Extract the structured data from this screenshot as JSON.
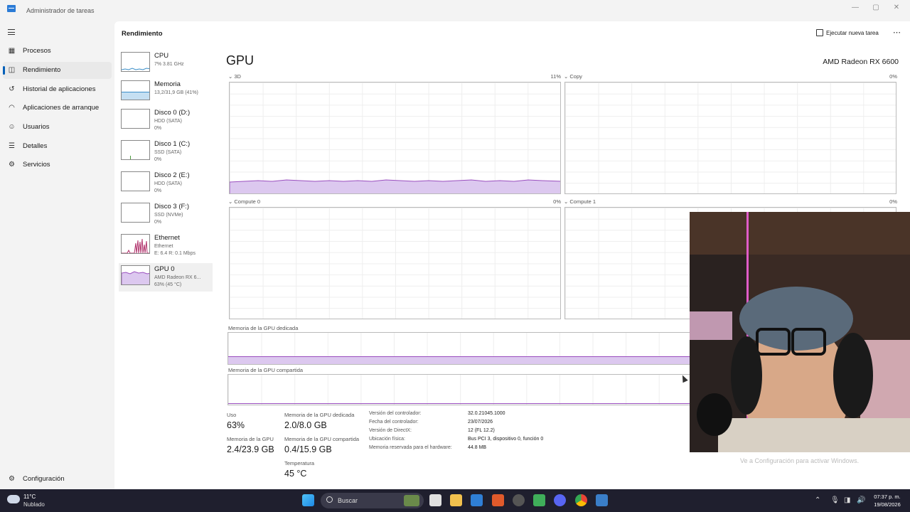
{
  "window": {
    "title": "Administrador de tareas",
    "minimize": "—",
    "maximize": "▢",
    "close": "✕"
  },
  "sidebar": {
    "items": [
      {
        "label": "Procesos",
        "icon": "processes-icon"
      },
      {
        "label": "Rendimiento",
        "icon": "performance-icon",
        "active": true
      },
      {
        "label": "Historial de aplicaciones",
        "icon": "history-icon"
      },
      {
        "label": "Aplicaciones de arranque",
        "icon": "startup-icon"
      },
      {
        "label": "Usuarios",
        "icon": "users-icon"
      },
      {
        "label": "Detalles",
        "icon": "details-icon"
      },
      {
        "label": "Servicios",
        "icon": "services-icon"
      }
    ],
    "settings_label": "Configuración"
  },
  "header": {
    "title": "Rendimiento",
    "run_task_label": "Ejecutar nueva tarea",
    "more": "⋯"
  },
  "resources": [
    {
      "name": "CPU",
      "line1": "7% 3.81 GHz",
      "line2": ""
    },
    {
      "name": "Memoria",
      "line1": "13,2/31,9 GB (41%)",
      "line2": ""
    },
    {
      "name": "Disco 0 (D:)",
      "line1": "HDD (SATA)",
      "line2": "0%"
    },
    {
      "name": "Disco 1 (C:)",
      "line1": "SSD (SATA)",
      "line2": "0%"
    },
    {
      "name": "Disco 2 (E:)",
      "line1": "HDD (SATA)",
      "line2": "0%"
    },
    {
      "name": "Disco 3 (F:)",
      "line1": "SSD (NVMe)",
      "line2": "0%"
    },
    {
      "name": "Ethernet",
      "line1": "Ethernet",
      "line2": "E: 6.4 R: 0.1 Mbps"
    },
    {
      "name": "GPU 0",
      "line1": "AMD Radeon RX 6...",
      "line2": "63% (45 °C)"
    }
  ],
  "gpu": {
    "title": "GPU",
    "model": "AMD Radeon RX 6600",
    "engines": [
      {
        "label": "3D",
        "pct": "11%"
      },
      {
        "label": "Copy",
        "pct": "0%"
      },
      {
        "label": "Compute 0",
        "pct": "0%"
      },
      {
        "label": "Compute 1",
        "pct": "0%"
      }
    ],
    "dedicated_label": "Memoria de la GPU dedicada",
    "shared_label": "Memoria de la GPU compartida",
    "stats": {
      "usage_label": "Uso",
      "usage": "63%",
      "gpu_mem_label": "Memoria de la GPU",
      "gpu_mem": "2.4/23.9 GB",
      "dedicated_label": "Memoria de la GPU dedicada",
      "dedicated": "2.0/8.0 GB",
      "shared_label": "Memoria de la GPU compartida",
      "shared": "0.4/15.9 GB",
      "temp_label": "Temperatura",
      "temp": "45 °C"
    },
    "info": [
      {
        "label": "Versión del controlador:",
        "value": "32.0.21045.1000"
      },
      {
        "label": "Fecha del controlador:",
        "value": "23/07/2026"
      },
      {
        "label": "Versión de DirectX:",
        "value": "12 (FL 12.2)"
      },
      {
        "label": "Ubicación física:",
        "value": "Bus PCI 3, dispositivo 0, función 0"
      },
      {
        "label": "Memoria reservada para el hardware:",
        "value": "44.8 MB"
      }
    ]
  },
  "activation_notice": "Ve a Configuración para activar Windows.",
  "taskbar": {
    "weather_temp": "11°C",
    "weather_desc": "Nublado",
    "search_placeholder": "Buscar",
    "time": "07:37 p. m.",
    "date": "19/08/2026"
  },
  "colors": {
    "accent": "#005fb8",
    "gpu_fill": "#dcc8ef",
    "gpu_line": "#9a4fbf",
    "taskbar": "#1f1f2e"
  }
}
